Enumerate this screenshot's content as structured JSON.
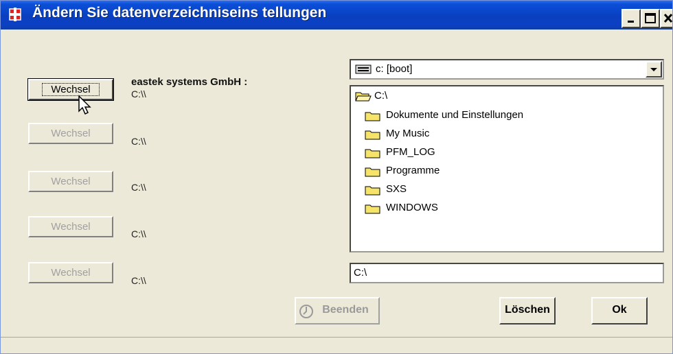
{
  "window": {
    "title": "Ändern Sie datenverzeichniseins tellungen",
    "controls": [
      "minimize",
      "maximize",
      "close"
    ]
  },
  "rows": [
    {
      "button_label": "Wechsel",
      "enabled": true,
      "path": "C:\\\\",
      "heading": "eastek systems GmbH :"
    },
    {
      "button_label": "Wechsel",
      "enabled": false,
      "path": "C:\\\\"
    },
    {
      "button_label": "Wechsel",
      "enabled": false,
      "path": "C:\\\\"
    },
    {
      "button_label": "Wechsel",
      "enabled": false,
      "path": "C:\\\\"
    },
    {
      "button_label": "Wechsel",
      "enabled": false,
      "path": "C:\\\\"
    }
  ],
  "drive_combo": {
    "value": "c: [boot]",
    "icon": "drive-icon"
  },
  "folder_list": {
    "root": "C:\\",
    "items": [
      "Dokumente und Einstellungen",
      "My Music",
      "PFM_LOG",
      "Programme",
      "SXS",
      "WINDOWS"
    ]
  },
  "path_input": {
    "value": "C:\\"
  },
  "buttons": {
    "beenden": "Beenden",
    "loeschen": "Löschen",
    "ok": "Ok"
  },
  "colors": {
    "title_bar": "#0a3fc0",
    "face": "#ece9d8",
    "folder": "#f5e36a"
  }
}
